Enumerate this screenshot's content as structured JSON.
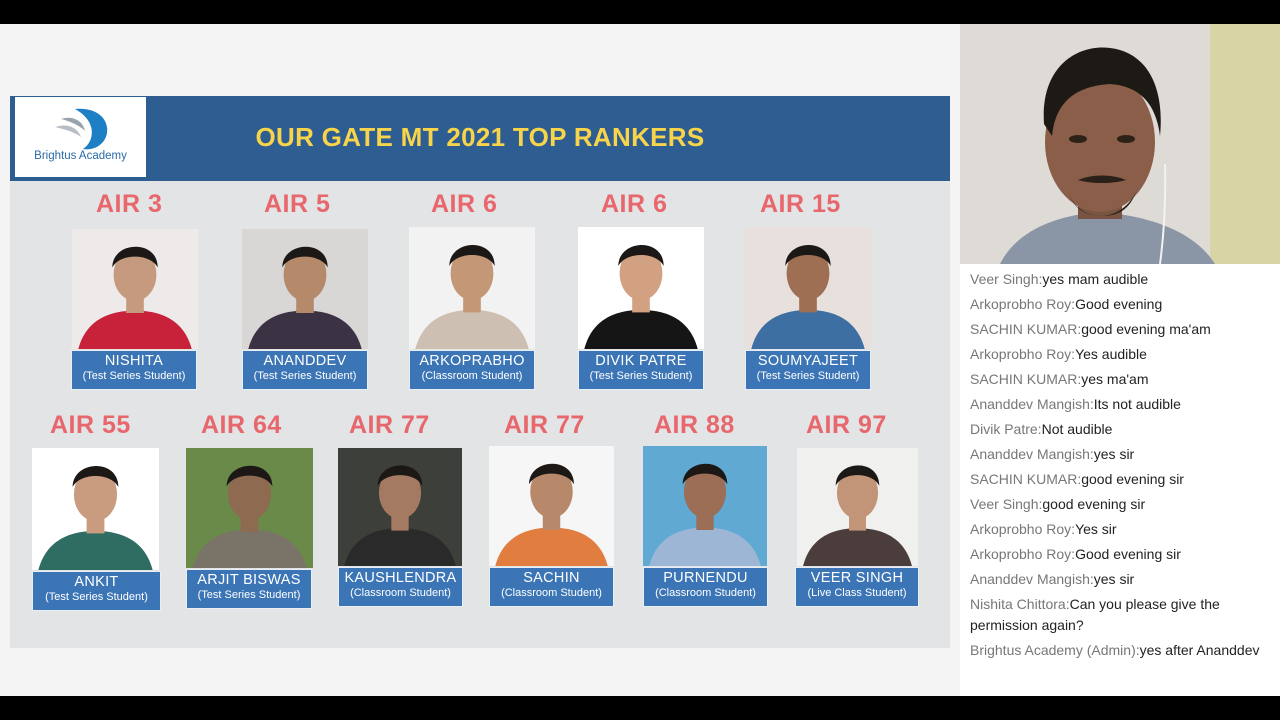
{
  "slide": {
    "title": "OUR GATE MT 2021 TOP RANKERS",
    "logo_text": "Brightus Academy",
    "rankers": [
      {
        "air": "AIR 3",
        "name": "NISHITA",
        "type": "(Test Series Student)",
        "shirt": "#c8213a",
        "skin": "#c69a7e",
        "bg": "#eeeaea"
      },
      {
        "air": "AIR 5",
        "name": "ANANDDEV",
        "type": "(Test Series Student)",
        "shirt": "#3b3244",
        "skin": "#b58a6b",
        "bg": "#d9d7d6"
      },
      {
        "air": "AIR 6",
        "name": "ARKOPRABHO",
        "type": "(Classroom Student)",
        "shirt": "#cdbfb2",
        "skin": "#c49777",
        "bg": "#f2f2f2"
      },
      {
        "air": "AIR 6",
        "name": "DIVIK PATRE",
        "type": "(Test Series Student)",
        "shirt": "#151515",
        "skin": "#d2a182",
        "bg": "#ffffff"
      },
      {
        "air": "AIR 15",
        "name": "SOUMYAJEET",
        "type": "(Test Series Student)",
        "shirt": "#3d6fa3",
        "skin": "#9e6f52",
        "bg": "#e8e0dd"
      },
      {
        "air": "AIR 55",
        "name": "ANKIT",
        "type": "(Test Series Student)",
        "shirt": "#2f6d63",
        "skin": "#c99c80",
        "bg": "#ffffff"
      },
      {
        "air": "AIR 64",
        "name": "ARJIT BISWAS",
        "type": "(Test Series Student)",
        "shirt": "#7a7468",
        "skin": "#8d6a50",
        "bg": "#6a8a4a"
      },
      {
        "air": "AIR 77",
        "name": "KAUSHLENDRA",
        "type": "(Classroom Student)",
        "shirt": "#2a2a2a",
        "skin": "#a47a62",
        "bg": "#3d3f3a"
      },
      {
        "air": "AIR 77",
        "name": "SACHIN",
        "type": "(Classroom Student)",
        "shirt": "#e07d3f",
        "skin": "#b8886b",
        "bg": "#f6f6f6"
      },
      {
        "air": "AIR 88",
        "name": "PURNENDU",
        "type": "(Classroom Student)",
        "shirt": "#9db6d6",
        "skin": "#9b6e55",
        "bg": "#5fa9d3"
      },
      {
        "air": "AIR 97",
        "name": "VEER SINGH",
        "type": "(Live Class Student)",
        "shirt": "#4a3d3c",
        "skin": "#c29478",
        "bg": "#f0f0ef"
      }
    ]
  },
  "chat": {
    "messages": [
      {
        "user": "Veer Singh:",
        "text": "yes mam audible"
      },
      {
        "user": "Arkoprobho Roy:",
        "text": "Good evening"
      },
      {
        "user": "SACHIN KUMAR:",
        "text": "good evening ma'am"
      },
      {
        "user": "Arkoprobho Roy:",
        "text": "Yes audible"
      },
      {
        "user": "SACHIN KUMAR:",
        "text": "yes ma'am"
      },
      {
        "user": "Ananddev Mangish:",
        "text": "Its not audible"
      },
      {
        "user": "Divik Patre:",
        "text": "Not audible"
      },
      {
        "user": "Ananddev Mangish:",
        "text": "yes sir"
      },
      {
        "user": "SACHIN KUMAR:",
        "text": "good evening sir"
      },
      {
        "user": "Veer Singh:",
        "text": "good evening sir"
      },
      {
        "user": "Arkoprobho Roy:",
        "text": "Yes sir"
      },
      {
        "user": "Arkoprobho Roy:",
        "text": "Good evening sir"
      },
      {
        "user": "Ananddev Mangish:",
        "text": "yes sir"
      },
      {
        "user": "Nishita Chittora:",
        "text": "Can you please give the permission again?"
      },
      {
        "user": "Brightus Academy (Admin):",
        "text": "yes after Ananddev"
      }
    ]
  }
}
